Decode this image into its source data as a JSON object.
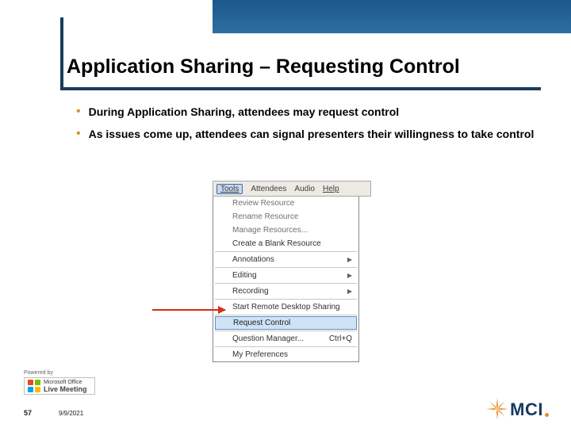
{
  "title": "Application Sharing – Requesting Control",
  "bullets": [
    "During Application Sharing, attendees may request control",
    "As issues come up, attendees can signal presenters their willingness to take control"
  ],
  "menu": {
    "menubar": [
      "Tools",
      "Attendees",
      "Audio",
      "Help"
    ],
    "items": [
      {
        "label": "Review Resource",
        "enabled": false
      },
      {
        "label": "Rename Resource",
        "enabled": false
      },
      {
        "label": "Manage Resources...",
        "enabled": false
      },
      {
        "label": "Create a Blank Resource",
        "enabled": true
      },
      {
        "sep": true
      },
      {
        "label": "Annotations",
        "submenu": true,
        "enabled": true
      },
      {
        "sep": true
      },
      {
        "label": "Editing",
        "submenu": true,
        "enabled": true
      },
      {
        "sep": true
      },
      {
        "label": "Recording",
        "submenu": true,
        "enabled": true
      },
      {
        "sep": true
      },
      {
        "label": "Start Remote Desktop Sharing",
        "enabled": true
      },
      {
        "sep": true
      },
      {
        "label": "Request Control",
        "enabled": true,
        "highlight": true
      },
      {
        "sep": true
      },
      {
        "label": "Question Manager...",
        "shortcut": "Ctrl+Q",
        "enabled": true
      },
      {
        "sep": true
      },
      {
        "label": "My Preferences",
        "enabled": true
      }
    ]
  },
  "footer": {
    "powered_by": "Powered by",
    "lm_top": "Microsoft Office",
    "lm_bottom": "Live Meeting",
    "page": "57",
    "date": "9/9/2021",
    "brand": "MCI"
  }
}
